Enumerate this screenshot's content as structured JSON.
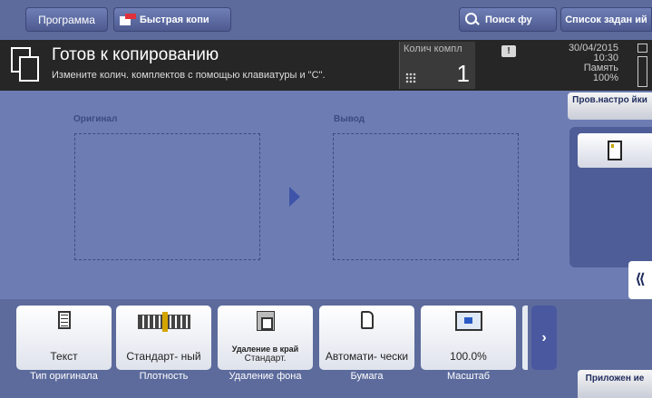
{
  "header": {
    "program_label": "Программа",
    "quick_copy_label": "Быстрая копи",
    "search_label": "Поиск фу",
    "job_list_label": "Список задан ий"
  },
  "status": {
    "title": "Готов к копированию",
    "message": "Измените колич. комплектов с помощью клавиатуры и \"С\".",
    "sets_label": "Колич компл",
    "sets_value": "1",
    "date": "30/04/2015",
    "time": "10:30",
    "memory_label": "Память",
    "memory_value": "100%"
  },
  "main": {
    "original_label": "Оригинал",
    "output_label": "Вывод"
  },
  "right_panel": {
    "check_settings_label": "Пров.настро йки",
    "apps_label": "Приложен ие"
  },
  "functions": [
    {
      "value": "Текст",
      "caption": "Тип оригинала",
      "icon": "text-document-icon"
    },
    {
      "value": "Стандарт- ный",
      "caption": "Плотность",
      "icon": "density-scale-icon"
    },
    {
      "value_bold": "Удаление в край",
      "value": "Стандарт.",
      "caption": "Удаление фона",
      "icon": "background-removal-icon"
    },
    {
      "value": "Автомати- чески",
      "caption": "Бумага",
      "icon": "paper-icon"
    },
    {
      "value": "100.0%",
      "caption": "Масштаб",
      "icon": "zoom-icon"
    }
  ],
  "colors": {
    "background": "#5c6b9c",
    "panel": "#6d7db4",
    "status_bar": "#262626",
    "accent_arrow": "#3f53a8"
  }
}
